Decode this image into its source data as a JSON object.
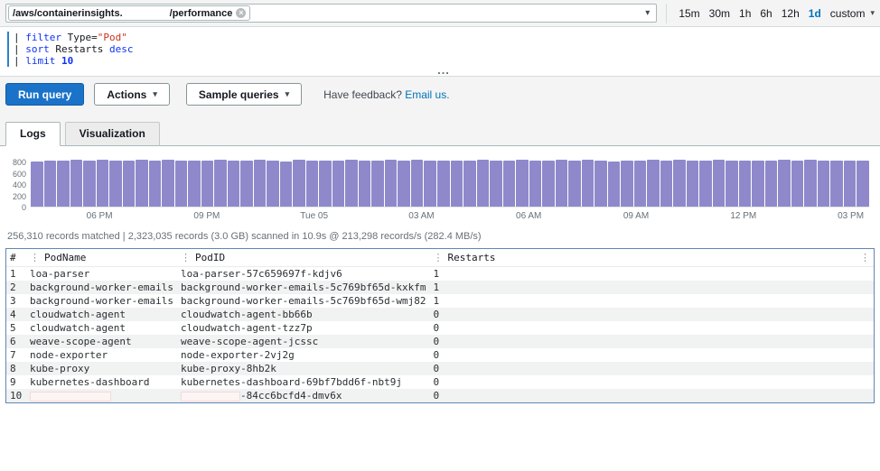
{
  "colors": {
    "accent_blue": "#0073bb",
    "run_button_bg": "#1a73c8",
    "keyword": "#1032f5",
    "string": "#c7341f",
    "number": "#1032f5",
    "bar_fill": "#8f89cb",
    "table_border": "#5f86b5"
  },
  "topbar": {
    "log_group_prefix": "/aws/containerinsights.",
    "log_group_redacted": true,
    "log_group_suffix": "/performance",
    "time_ranges": [
      "15m",
      "30m",
      "1h",
      "6h",
      "12h",
      "1d",
      "custom"
    ],
    "selected_range": "1d"
  },
  "query": {
    "lines": [
      {
        "tokens": [
          {
            "text": "| ",
            "type": "plain"
          },
          {
            "text": "filter",
            "type": "kw"
          },
          {
            "text": " Type=",
            "type": "plain"
          },
          {
            "text": "\"Pod\"",
            "type": "str"
          }
        ]
      },
      {
        "tokens": [
          {
            "text": "| ",
            "type": "plain"
          },
          {
            "text": "sort",
            "type": "kw"
          },
          {
            "text": " Restarts ",
            "type": "plain"
          },
          {
            "text": "desc",
            "type": "kw"
          }
        ]
      },
      {
        "tokens": [
          {
            "text": "| ",
            "type": "plain"
          },
          {
            "text": "limit",
            "type": "kw"
          },
          {
            "text": " ",
            "type": "plain"
          },
          {
            "text": "10",
            "type": "num"
          }
        ]
      }
    ],
    "resize_handle": "..."
  },
  "toolbar": {
    "run_query": "Run query",
    "actions": "Actions",
    "sample_queries": "Sample queries",
    "feedback_text": "Have feedback?",
    "feedback_link": "Email us."
  },
  "tabs": [
    {
      "label": "Logs",
      "active": true
    },
    {
      "label": "Visualization",
      "active": false
    }
  ],
  "chart_data": {
    "type": "bar",
    "title": "",
    "xlabel": "",
    "ylabel": "",
    "x_ticks": [
      "06 PM",
      "09 PM",
      "Tue 05",
      "03 AM",
      "06 AM",
      "09 AM",
      "12 PM",
      "03 PM"
    ],
    "y_ticks": [
      0,
      200,
      400,
      600,
      800
    ],
    "ylim": [
      0,
      900
    ],
    "grid": false,
    "legend_position": "none",
    "values": [
      826,
      842,
      835,
      848,
      830,
      844,
      838,
      827,
      845,
      836,
      850,
      832,
      841,
      828,
      846,
      838,
      831,
      843,
      836,
      826,
      845,
      834,
      840,
      830,
      847,
      838,
      828,
      843,
      832,
      846,
      836,
      827,
      841,
      834,
      849,
      830,
      838,
      845,
      828,
      836,
      843,
      832,
      847,
      838,
      826,
      841,
      834,
      845,
      830,
      843,
      836,
      828,
      846,
      838,
      832,
      841,
      827,
      844,
      836,
      849,
      831,
      835,
      842,
      829
    ]
  },
  "status_line": "256,310 records matched | 2,323,035 records (3.0 GB) scanned in 10.9s @ 213,298 records/s (282.4 MB/s)",
  "results_table": {
    "columns": [
      "#",
      "PodName",
      "PodID",
      "Restarts"
    ],
    "rows": [
      {
        "num": "1",
        "pod_name": "loa-parser",
        "pod_id": "loa-parser-57c659697f-kdjv6",
        "restarts": "1"
      },
      {
        "num": "2",
        "pod_name": "background-worker-emails",
        "pod_id": "background-worker-emails-5c769bf65d-kxkfm",
        "restarts": "1"
      },
      {
        "num": "3",
        "pod_name": "background-worker-emails",
        "pod_id": "background-worker-emails-5c769bf65d-wmj82",
        "restarts": "1"
      },
      {
        "num": "4",
        "pod_name": "cloudwatch-agent",
        "pod_id": "cloudwatch-agent-bb66b",
        "restarts": "0"
      },
      {
        "num": "5",
        "pod_name": "cloudwatch-agent",
        "pod_id": "cloudwatch-agent-tzz7p",
        "restarts": "0"
      },
      {
        "num": "6",
        "pod_name": "weave-scope-agent",
        "pod_id": "weave-scope-agent-jcssc",
        "restarts": "0"
      },
      {
        "num": "7",
        "pod_name": "node-exporter",
        "pod_id": "node-exporter-2vj2g",
        "restarts": "0"
      },
      {
        "num": "8",
        "pod_name": "kube-proxy",
        "pod_id": "kube-proxy-8hb2k",
        "restarts": "0"
      },
      {
        "num": "9",
        "pod_name": "kubernetes-dashboard",
        "pod_id": "kubernetes-dashboard-69bf7bdd6f-nbt9j",
        "restarts": "0"
      },
      {
        "num": "10",
        "pod_name": "",
        "pod_id": "-84cc6bcfd4-dmv6x",
        "restarts": "0",
        "redacted": true
      }
    ]
  }
}
